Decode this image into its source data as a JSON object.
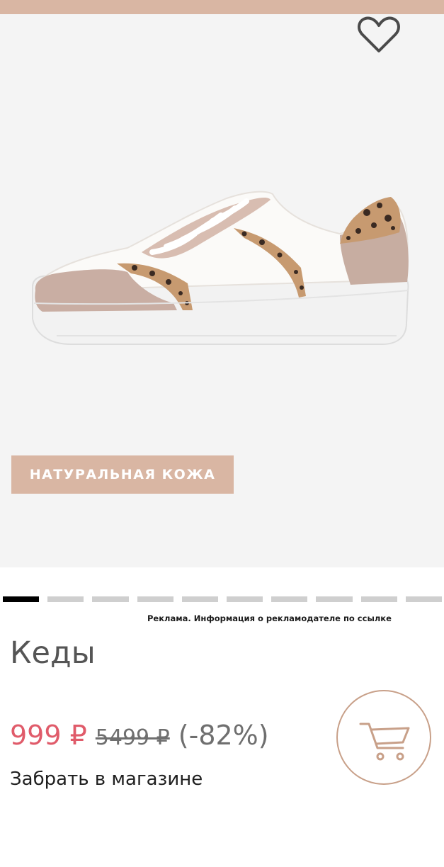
{
  "colors": {
    "accent": "#d9b6a3",
    "price_red": "#e05b6a",
    "text_gray": "#6f6f6f",
    "carousel_active": "#000000",
    "carousel_inactive": "#cfcfcf"
  },
  "product": {
    "badge": "НАТУРАЛЬНАЯ КОЖА",
    "ad_disclaimer": "Реклама. Информация о рекламодателе по ссылке",
    "title": "Кеды",
    "price_current": "999 ₽",
    "price_old": "5499 ₽",
    "discount": "(-82%)",
    "pickup": "Забрать в магазине"
  },
  "carousel": {
    "count": 10,
    "active_index": 0
  },
  "icons": {
    "favorite": "heart-outline-icon",
    "cart": "shopping-cart-icon"
  }
}
